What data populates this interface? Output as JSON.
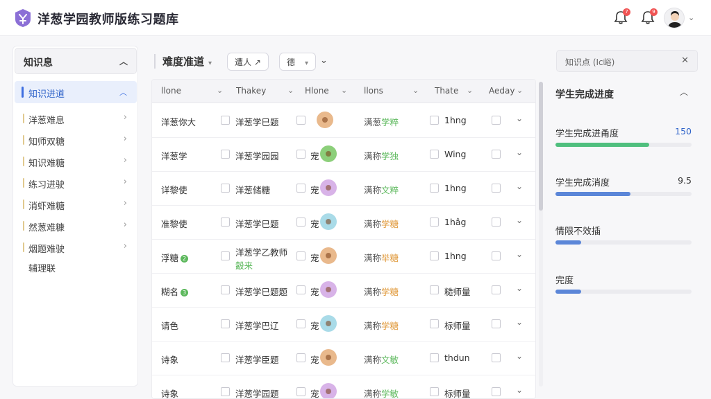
{
  "app": {
    "title": "洋葱学园教师版练习题库"
  },
  "header": {
    "notifications": [
      {
        "badge": "7"
      },
      {
        "badge": "9"
      }
    ]
  },
  "sidebar": {
    "title": "知识息",
    "active_item": "知识进道",
    "items": [
      {
        "label": "洋葱难息"
      },
      {
        "label": "知师双糖"
      },
      {
        "label": "知识难糖"
      },
      {
        "label": "练习进驶"
      },
      {
        "label": "消虾难糖"
      },
      {
        "label": "然葱难糠"
      },
      {
        "label": "烟题难驶"
      }
    ],
    "plain_item": "辅理联"
  },
  "toolbar": {
    "title": "难度准道",
    "filter_1": "遭人 ↗",
    "filter_2": "德"
  },
  "table": {
    "columns": [
      "llone",
      "Thakey",
      "Hlone",
      "llons",
      "Thate",
      "Aeday"
    ],
    "rows": [
      {
        "name": "洋葱你大",
        "badge": "",
        "col2": "洋葱学巳题",
        "col2_sub": "",
        "col3_prefix": "",
        "icon_color": "#e9b98c",
        "col4a": "满葱",
        "col4b": "学粹",
        "col4b_color": "#5cb85c",
        "col5": "1hng"
      },
      {
        "name": "洋葱学",
        "badge": "",
        "col2": "洋葱学园园",
        "col2_sub": "",
        "col3_prefix": "宠",
        "icon_color": "#8ccf7a",
        "col4a": "满称",
        "col4b": "学独",
        "col4b_color": "#5cb85c",
        "col5": "Wing"
      },
      {
        "name": "详黎使",
        "badge": "",
        "col2": "洋葱储糖",
        "col2_sub": "",
        "col3_prefix": "宠",
        "icon_color": "#d8b3e8",
        "col4a": "满称",
        "col4b": "文粹",
        "col4b_color": "#5cb85c",
        "col5": "1hng"
      },
      {
        "name": "准黎使",
        "badge": "",
        "col2": "洋葱学巳题",
        "col2_sub": "",
        "col3_prefix": "宠",
        "icon_color": "#a9dbe8",
        "col4a": "满称",
        "col4b": "学糖",
        "col4b_color": "#e09a3c",
        "col5": "1hâg"
      },
      {
        "name": "浮糖",
        "badge": "2",
        "col2": "洋葱学乙教师",
        "col2_sub": "觳来",
        "col3_prefix": "宠",
        "icon_color": "#e9b98c",
        "col4a": "满称",
        "col4b": "举糖",
        "col4b_color": "#e09a3c",
        "col5": "1hng"
      },
      {
        "name": "糊名",
        "badge": "3",
        "col2": "洋葱学巳题题",
        "col2_sub": "",
        "col3_prefix": "宠",
        "icon_color": "#d8b3e8",
        "col4a": "满称",
        "col4b": "学糖",
        "col4b_color": "#e09a3c",
        "col5": "糙师量"
      },
      {
        "name": "请色",
        "badge": "",
        "col2": "洋葱学巴辽",
        "col2_sub": "",
        "col3_prefix": "宠",
        "icon_color": "#a9dbe8",
        "col4a": "满称",
        "col4b": "学糖",
        "col4b_color": "#e09a3c",
        "col5": "标师量"
      },
      {
        "name": "诗象",
        "badge": "",
        "col2": "洋葱学臣题",
        "col2_sub": "",
        "col3_prefix": "宠",
        "icon_color": "#e9b98c",
        "col4a": "满称",
        "col4b": "文敏",
        "col4b_color": "#5cb85c",
        "col5": "thdun"
      },
      {
        "name": "诗象",
        "badge": "",
        "col2": "洋葱学园题",
        "col2_sub": "",
        "col3_prefix": "宠",
        "icon_color": "#d8b3e8",
        "col4a": "满称",
        "col4b": "学敏",
        "col4b_color": "#5cb85c",
        "col5": "标师量"
      }
    ]
  },
  "right_panel": {
    "search_text": "知识点 (Ic峪)",
    "title": "学生完成进度",
    "progress": [
      {
        "label": "学生完成进甬度",
        "value": "150",
        "fraction": 0.69,
        "color": "#4fbf7e",
        "value_color": "#2f63c9"
      },
      {
        "label": "学生完成消度",
        "value": "9.5",
        "fraction": 0.55,
        "color": "#5b86d8",
        "value_color": "#333333"
      },
      {
        "label": "情限不效插",
        "value": "",
        "fraction": 0.19,
        "color": "#5b86d8",
        "value_color": "#333333"
      },
      {
        "label": "完度",
        "value": "",
        "fraction": 0.19,
        "color": "#5b86d8",
        "value_color": "#333333"
      }
    ]
  }
}
